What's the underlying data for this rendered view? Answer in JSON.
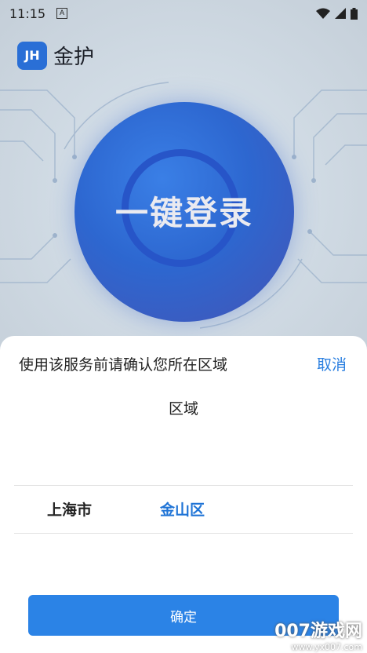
{
  "status_bar": {
    "time": "11:15",
    "notification_icon": "A"
  },
  "app": {
    "logo_text": "JH",
    "name": "金护"
  },
  "login": {
    "label": "一键登录"
  },
  "sheet": {
    "title": "使用该服务前请确认您所在区域",
    "cancel_label": "取消",
    "region_header": "区域",
    "selection": {
      "city": "上海市",
      "district": "金山区"
    },
    "confirm_label": "确定"
  },
  "watermark": {
    "brand": "007游戏网",
    "url": "www.yx007.com"
  },
  "colors": {
    "accent": "#2b83e6",
    "district": "#1f74d6",
    "orb": "#2d67d0"
  }
}
